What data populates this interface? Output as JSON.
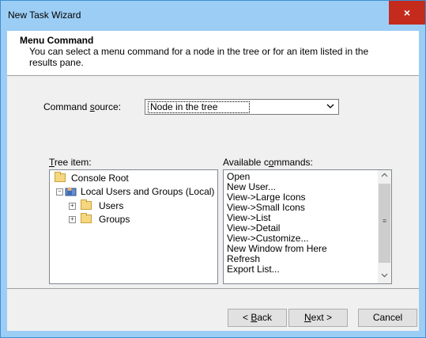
{
  "window": {
    "title": "New Task Wizard",
    "close_glyph": "×"
  },
  "header": {
    "title": "Menu Command",
    "description": "You can select a menu command for a node in the tree or for an item listed in the results pane."
  },
  "command_source": {
    "label_pre": "Command ",
    "label_u": "s",
    "label_post": "ource:",
    "value": "Node in the tree"
  },
  "tree": {
    "label_u": "T",
    "label_post": "ree item:",
    "items": [
      {
        "label": "Console Root"
      },
      {
        "label": "Local Users and Groups (Local)"
      },
      {
        "label": "Users"
      },
      {
        "label": "Groups"
      }
    ]
  },
  "commands": {
    "label_pre": "Available c",
    "label_u": "o",
    "label_post": "mmands:",
    "items": [
      "Open",
      "New User...",
      "View->Large Icons",
      "View->Small Icons",
      "View->List",
      "View->Detail",
      "View->Customize...",
      "New Window from Here",
      "Refresh",
      "Export List..."
    ]
  },
  "buttons": {
    "back": {
      "pre": "< ",
      "u": "B",
      "post": "ack"
    },
    "next": {
      "pre": "",
      "u": "N",
      "post": "ext >"
    },
    "cancel": "Cancel"
  }
}
